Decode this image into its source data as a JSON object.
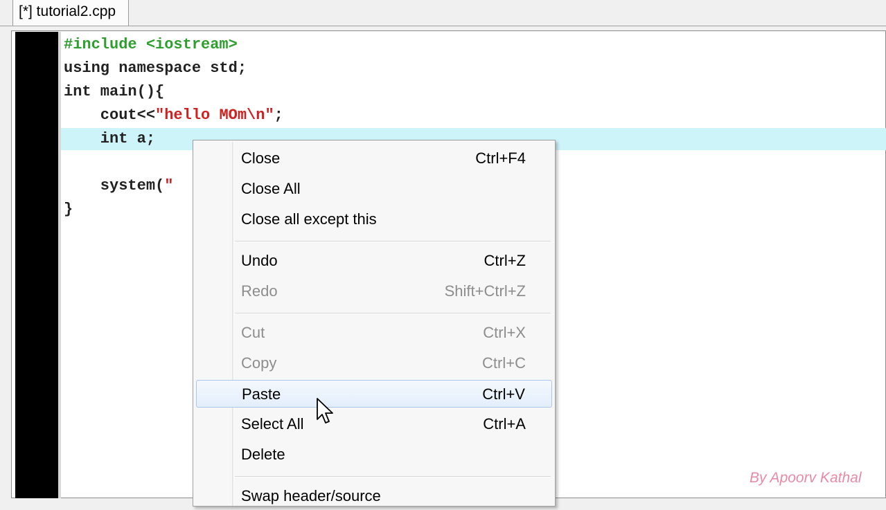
{
  "tab": {
    "label": "[*] tutorial2.cpp"
  },
  "code": {
    "line1": "#include <iostream>",
    "line2": "using namespace std;",
    "line3": "int main(){",
    "line4_prefix": "    cout<<",
    "line4_string": "\"hello MOm\\n\"",
    "line4_suffix": ";",
    "line5": "    int a;",
    "line7_prefix": "    system(",
    "line7_string": "\"",
    "line8": "}"
  },
  "context_menu": {
    "items": [
      {
        "label": "Close",
        "shortcut": "Ctrl+F4",
        "enabled": true
      },
      {
        "label": "Close All",
        "shortcut": "",
        "enabled": true
      },
      {
        "label": "Close all except this",
        "shortcut": "",
        "enabled": true
      },
      {
        "label": "Undo",
        "shortcut": "Ctrl+Z",
        "enabled": true
      },
      {
        "label": "Redo",
        "shortcut": "Shift+Ctrl+Z",
        "enabled": false
      },
      {
        "label": "Cut",
        "shortcut": "Ctrl+X",
        "enabled": false
      },
      {
        "label": "Copy",
        "shortcut": "Ctrl+C",
        "enabled": false
      },
      {
        "label": "Paste",
        "shortcut": "Ctrl+V",
        "enabled": true,
        "highlighted": true
      },
      {
        "label": "Select All",
        "shortcut": "Ctrl+A",
        "enabled": true
      },
      {
        "label": "Delete",
        "shortcut": "",
        "enabled": true
      },
      {
        "label": "Swap header/source",
        "shortcut": "",
        "enabled": true
      }
    ]
  },
  "watermark": "By Apoorv Kathal",
  "icons": {
    "cursor": "mouse-pointer-icon"
  },
  "colors": {
    "current_line": "#cdf4f9",
    "preprocessor": "#2e9e2e",
    "string": "#d02020",
    "gutter": "#000000",
    "watermark": "#e88aa4"
  }
}
